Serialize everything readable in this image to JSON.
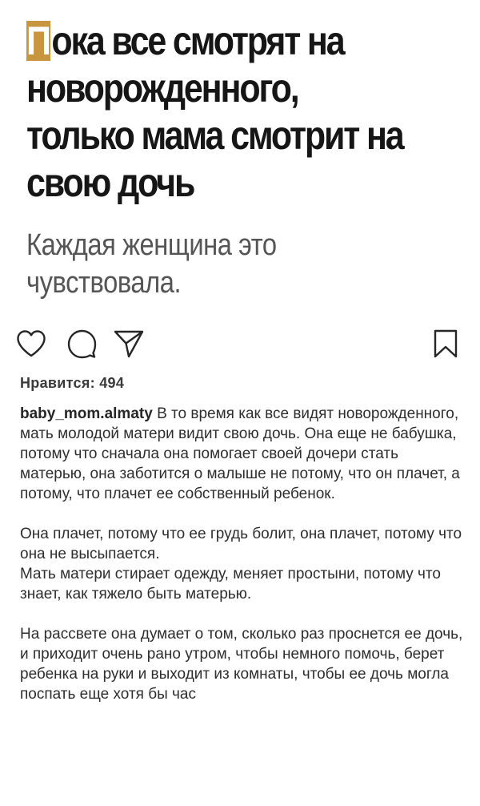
{
  "post_image": {
    "headline_first_letter": "П",
    "headline_rest": "ока все смотрят на новорожденного, только мама смотрит на свою дочь",
    "subheadline": "Каждая женщина это чувствовала.",
    "accent_color": "#c8963e"
  },
  "actions": {
    "like_icon": "heart-outline-icon",
    "comment_icon": "comment-bubble-icon",
    "share_icon": "paper-plane-icon",
    "save_icon": "bookmark-outline-icon"
  },
  "likes_text": "Нравится: 494",
  "caption": {
    "username": "baby_mom.almaty",
    "paragraph_1": "В то время как все видят новорожденного, мать молодой матери видит свою дочь. Она еще не бабушка, потому что сначала она помогает своей дочери стать матерью, она заботится о малыше не потому, что он плачет, а потому, что плачет ее собственный ребенок.",
    "paragraph_2a": "Она плачет, потому что ее грудь болит, она плачет, потому что она не высыпается.",
    "paragraph_2b": "Мать матери стирает одежду, меняет простыни, потому что знает, как тяжело быть матерью.",
    "paragraph_3": "На рассвете она думает о том, сколько раз проснется ее дочь, и приходит очень рано утром, чтобы немного помочь, берет ребенка на руки и выходит из комнаты, чтобы ее дочь могла поспать еще хотя бы час"
  }
}
